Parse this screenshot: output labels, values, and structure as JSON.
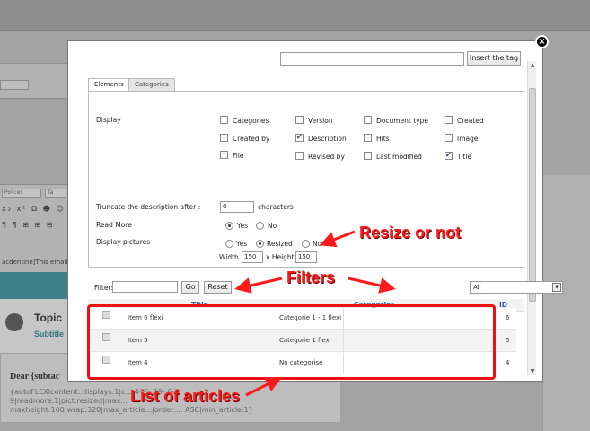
{
  "background": {
    "toolbar_label_a": "Polices",
    "toolbar_label_b": "Ta",
    "toolbar_row1": "x₂ x² Ω ☻ ☺",
    "toolbar_row2": "¶ ¶ ⊞ ⊞ ⊟",
    "snippet": "acdentine]This email",
    "topic_title": "Topic",
    "topic_subtitle": "Subtitle",
    "dear_line": "Dear {subtac",
    "code_line1": "{autoFLEXIcontent::displays:1|c...  4- 5- 19- 6-",
    "code_line2": "9|readmore:1|pict:resized|max...",
    "code_line3": "maxheight:100|wrap:320|max_article...|order:... ASC|min_article:1}"
  },
  "modal": {
    "insert_tag_label": "Insert the tag",
    "close_symbol": "×",
    "tabs": [
      {
        "label": "Elements"
      },
      {
        "label": "Categories"
      }
    ],
    "display_label": "Display",
    "display_options": [
      {
        "label": "Categories",
        "checked": false
      },
      {
        "label": "Version",
        "checked": false
      },
      {
        "label": "Document type",
        "checked": false
      },
      {
        "label": "Created",
        "checked": false
      },
      {
        "label": "Created by",
        "checked": false
      },
      {
        "label": "Description",
        "checked": true
      },
      {
        "label": "Hits",
        "checked": false
      },
      {
        "label": "Image",
        "checked": false
      },
      {
        "label": "File",
        "checked": false
      },
      {
        "label": "Revised by",
        "checked": false
      },
      {
        "label": "Last modified",
        "checked": false
      },
      {
        "label": "Title",
        "checked": true
      }
    ],
    "truncate_label": "Truncate the description after :",
    "truncate_value": "0",
    "characters_label": "characters",
    "read_more_label": "Read More",
    "read_more_yes": "Yes",
    "read_more_no": "No",
    "read_more_selected": "Yes",
    "display_pictures_label": "Display pictures",
    "pictures_yes": "Yes",
    "pictures_resized": "Resized",
    "pictures_no": "No",
    "pictures_selected": "Resized",
    "width_label": "Width",
    "width_value": "150",
    "height_label": "x Height",
    "height_value": "150",
    "filter_label": "Filter:",
    "filter_value": "",
    "go_label": "Go",
    "reset_label": "Reset",
    "category_select_value": "All",
    "table": {
      "columns": [
        "Title",
        "Categories",
        "ID"
      ],
      "rows": [
        {
          "title": "Item 6 flexi",
          "category": "Categorie 1 - 1 flexi",
          "id": "6"
        },
        {
          "title": "Item 5",
          "category": "Categorie 1 flexi",
          "id": "5"
        },
        {
          "title": "Item 4",
          "category": "No categorise",
          "id": "4"
        }
      ]
    }
  },
  "annotations": {
    "resize": "Resize or not",
    "filters": "Filters",
    "list": "List of articles",
    "color": "#ff1a1a"
  }
}
